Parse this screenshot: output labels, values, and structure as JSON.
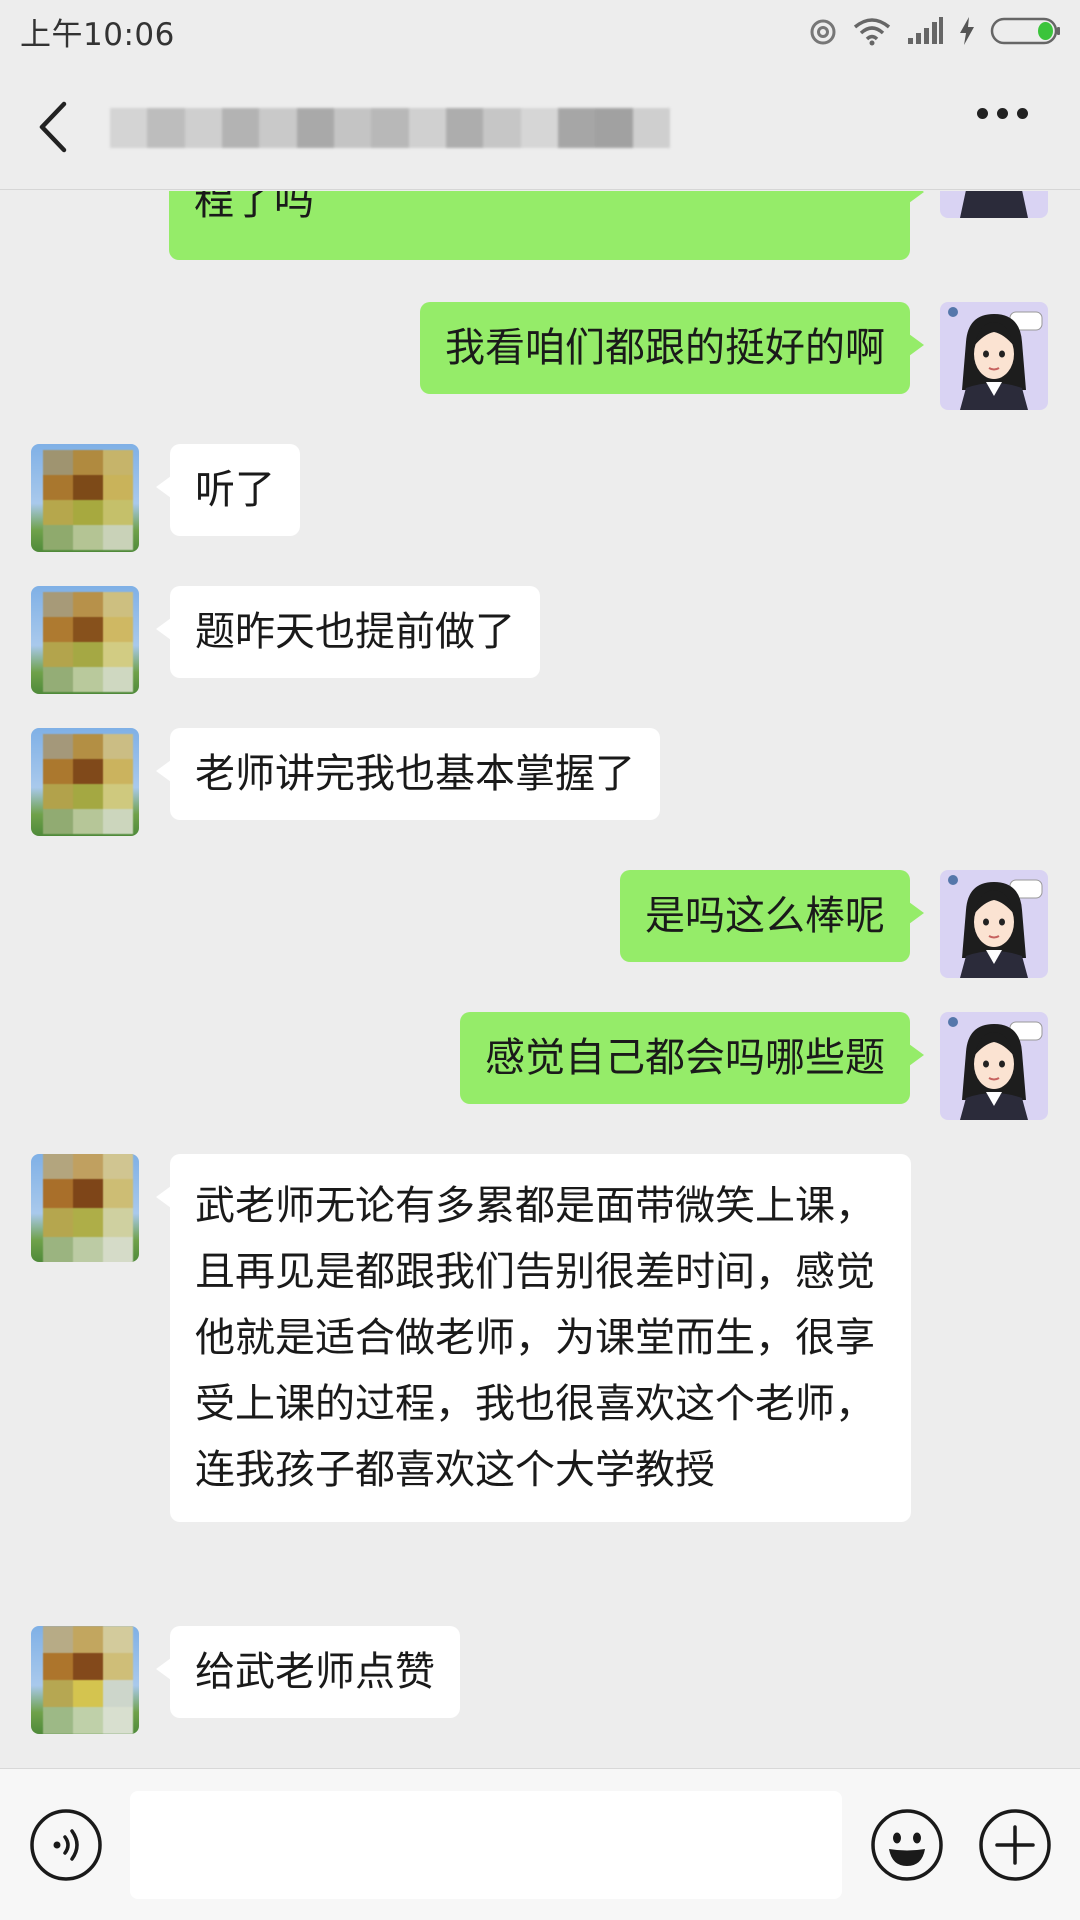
{
  "status_bar": {
    "time": "上午10:06",
    "icons": [
      "alarm-icon",
      "wifi-icon",
      "signal-icon",
      "charging-icon",
      "battery-icon"
    ],
    "battery_color": "#3bc43b"
  },
  "title_bar": {
    "back_icon": "chevron-left-icon",
    "title_obscured": true,
    "more_icon": "more-dots-icon"
  },
  "messages": [
    {
      "sender": "me",
      "text": "程了吗"
    },
    {
      "sender": "me",
      "text": "我看咱们都跟的挺好的啊"
    },
    {
      "sender": "contact",
      "text": "听了"
    },
    {
      "sender": "contact",
      "text": "题昨天也提前做了"
    },
    {
      "sender": "contact",
      "text": "老师讲完我也基本掌握了"
    },
    {
      "sender": "me",
      "text": "是吗这么棒呢"
    },
    {
      "sender": "me",
      "text": "感觉自己都会吗哪些题"
    },
    {
      "sender": "contact",
      "text": "武老师无论有多累都是面带微笑上课，且再见是都跟我们告别很差时间，感觉他就是适合做老师，为课堂而生，很享受上课的过程，我也很喜欢这个老师，连我孩子都喜欢这个大学教授"
    },
    {
      "sender": "contact",
      "text": "给武老师点赞"
    }
  ],
  "input_bar": {
    "voice_icon": "voice-icon",
    "text_value": "",
    "emoji_icon": "emoji-icon",
    "plus_icon": "plus-icon"
  },
  "colors": {
    "background": "#ededed",
    "outgoing_bubble": "#95ec69",
    "incoming_bubble": "#ffffff"
  }
}
